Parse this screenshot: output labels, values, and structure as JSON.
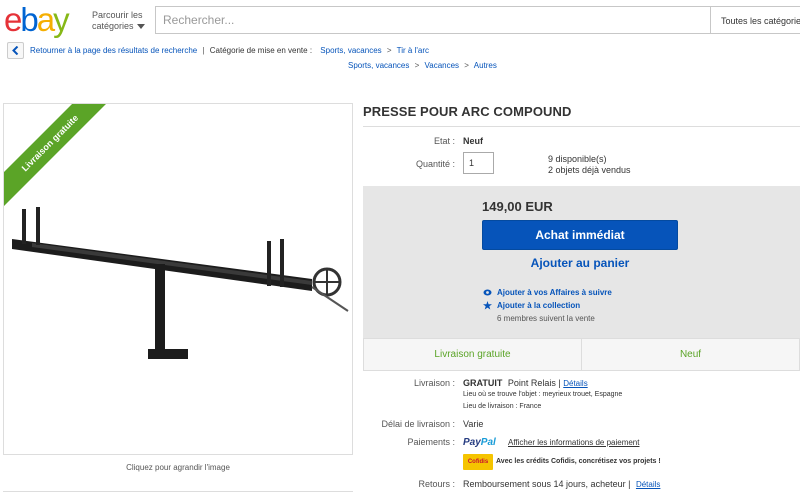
{
  "header": {
    "logo": {
      "e": "e",
      "b": "b",
      "a": "a",
      "y": "y"
    },
    "browse_line1": "Parcourir les",
    "browse_line2": "catégories",
    "search_placeholder": "Rechercher...",
    "category_select": "Toutes les catégories"
  },
  "breadcrumb": {
    "back_label": "Retourner à la page des résultats de recherche",
    "category_label": "Catégorie de mise en vente :",
    "path1": [
      "Sports, vacances",
      "Tir à l'arc"
    ],
    "path2": [
      "Sports, vacances",
      "Vacances",
      "Autres"
    ]
  },
  "image": {
    "ribbon": "Livraison gratuite",
    "enlarge": "Cliquez pour agrandir l'image"
  },
  "item": {
    "title": "PRESSE POUR ARC COMPOUND",
    "state_label": "Etat :",
    "state_value": "Neuf",
    "qty_label": "Quantité :",
    "qty_value": "1",
    "available": "9 disponible(s)",
    "sold": "2 objets déjà vendus",
    "price": "149,00 EUR",
    "buy_now": "Achat immédiat",
    "add_to_cart": "Ajouter au panier",
    "watch": "Ajouter à vos Affaires à suivre",
    "collection": "Ajouter à la collection",
    "watchers": "6 membres suivent la vente",
    "free_shipping": "Livraison gratuite",
    "condition_badge": "Neuf"
  },
  "details": {
    "shipping_label": "Livraison :",
    "shipping_free": "GRATUIT",
    "shipping_method": "Point Relais |",
    "shipping_details": "Détails",
    "location": "Lieu où se trouve l'objet : meyrieux trouet, Espagne",
    "ship_to": "Lieu de livraison : France",
    "delay_label": "Délai de livraison :",
    "delay_value": "Varie",
    "payment_label": "Paiements :",
    "paypal_1": "Pay",
    "paypal_2": "Pal",
    "payment_info": "Afficher les informations de paiement",
    "cofidis_logo": "Cofidis",
    "cofidis_text": "Avec les crédits Cofidis, concrétisez vos projets !",
    "returns_label": "Retours :",
    "returns_value": "Remboursement sous 14 jours, acheteur |",
    "returns_details": "Détails"
  },
  "colors": {
    "brand_blue": "#0654ba",
    "green": "#5ba427",
    "buybox_bg": "#e6e6e6"
  }
}
